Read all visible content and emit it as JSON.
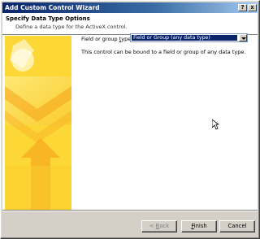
{
  "window": {
    "title": "Add Custom Control Wizard",
    "help_glyph": "?",
    "close_glyph": "x"
  },
  "header": {
    "title": "Specify Data Type Options",
    "subtitle": "Define a data type for the ActiveX control."
  },
  "form": {
    "field_label_pre": "Field or group ",
    "field_label_ul": "t",
    "field_label_post": "ype:",
    "field_value": "Field or Group (any data type)",
    "description": "This control can be bound to a field or group of any data type."
  },
  "buttons": {
    "back_prefix": "< ",
    "back_ul": "B",
    "back_rest": "ack",
    "finish_ul": "F",
    "finish_rest": "inish",
    "cancel_label": "Cancel"
  },
  "colors": {
    "art_yellow": "#fdd938",
    "art_orange": "#f6a21a",
    "selection": "#0a246a"
  }
}
